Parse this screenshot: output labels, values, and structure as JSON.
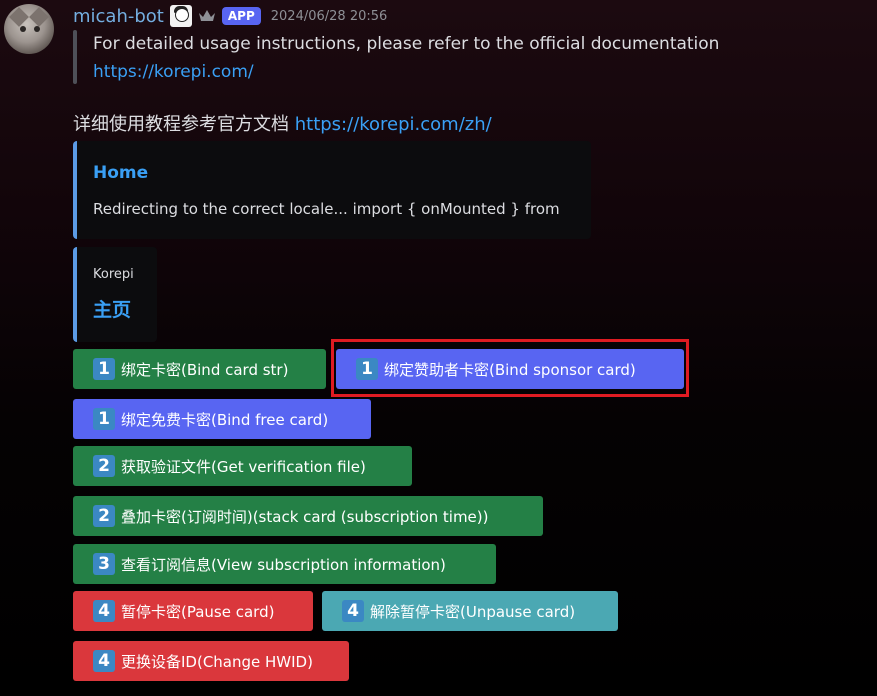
{
  "message": {
    "username": "micah-bot",
    "app_badge": "APP",
    "timestamp": "2024/06/28 20:56",
    "quote_line1": "For detailed usage instructions, please refer to the official documentation",
    "quote_link": "https://korepi.com/",
    "zh_text": "详细使用教程参考官方文档 ",
    "zh_link": "https://korepi.com/zh/"
  },
  "embeds": [
    {
      "title": "Home",
      "description": "Redirecting to the correct locale... import { onMounted } from"
    },
    {
      "provider": "Korepi",
      "title": "主页"
    }
  ],
  "buttons": [
    {
      "num": "1",
      "label": "绑定卡密(Bind card str)",
      "color": "#248046"
    },
    {
      "num": "1",
      "label": "绑定赞助者卡密(Bind sponsor card)",
      "color": "#5865f2"
    },
    {
      "num": "1",
      "label": "绑定免费卡密(Bind free card)",
      "color": "#5865f2"
    },
    {
      "num": "2",
      "label": "获取验证文件(Get verification file)",
      "color": "#248046"
    },
    {
      "num": "2",
      "label": "叠加卡密(订阅时间)(stack card (subscription time))",
      "color": "#248046"
    },
    {
      "num": "3",
      "label": "查看订阅信息(View subscription information)",
      "color": "#248046"
    },
    {
      "num": "4",
      "label": "暂停卡密(Pause card)",
      "color": "#da373c"
    },
    {
      "num": "4",
      "label": "解除暂停卡密(Unpause card)",
      "color": "#4ba8b3"
    },
    {
      "num": "4",
      "label": "更换设备ID(Change HWID)",
      "color": "#da373c"
    }
  ],
  "icons": {
    "avatar": "cat-avatar",
    "badge": "anime-badge-icon",
    "crown": "crown-icon"
  },
  "highlight_color": "#e01b22"
}
